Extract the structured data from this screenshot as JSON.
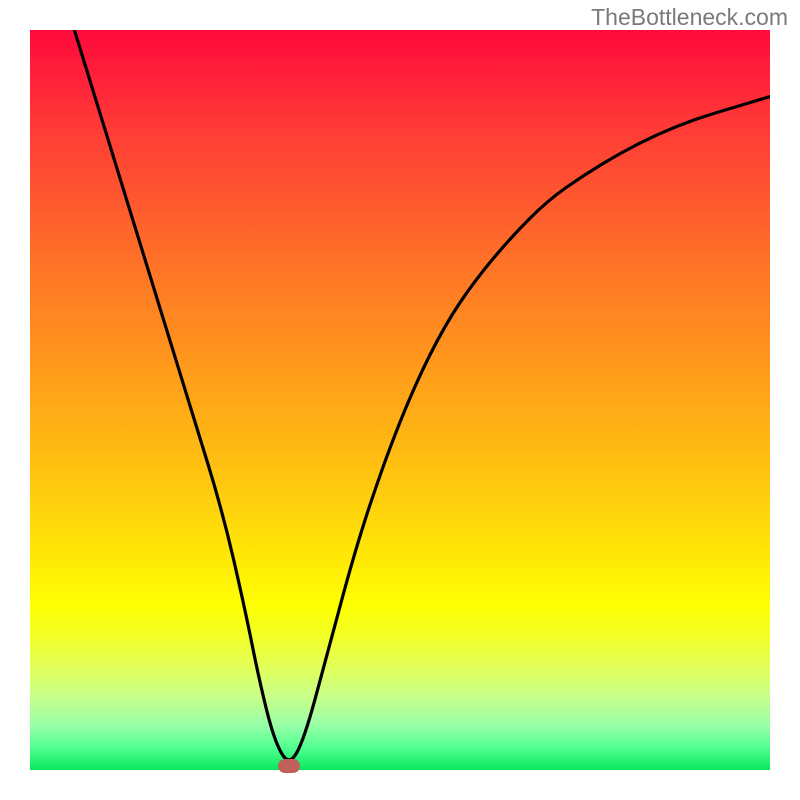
{
  "attribution": "TheBottleneck.com",
  "chart_data": {
    "type": "line",
    "title": "",
    "xlabel": "",
    "ylabel": "",
    "xlim": [
      0,
      100
    ],
    "ylim": [
      0,
      100
    ],
    "series": [
      {
        "name": "curve",
        "x": [
          6,
          10,
          14,
          18,
          22,
          26,
          29,
          31,
          33,
          35,
          37,
          40,
          44,
          48,
          52,
          56,
          60,
          65,
          70,
          75,
          80,
          85,
          90,
          95,
          100
        ],
        "y": [
          100,
          87,
          74,
          61,
          48,
          35,
          22,
          12,
          4,
          0.5,
          4,
          15,
          30,
          42,
          52,
          60,
          66,
          72,
          77,
          80.5,
          83.5,
          86,
          88,
          89.5,
          91
        ]
      }
    ],
    "marker": {
      "x": 35,
      "y": 0.5
    },
    "background_gradient": {
      "top": "#ff0a3a",
      "bottom": "#08e860"
    }
  }
}
